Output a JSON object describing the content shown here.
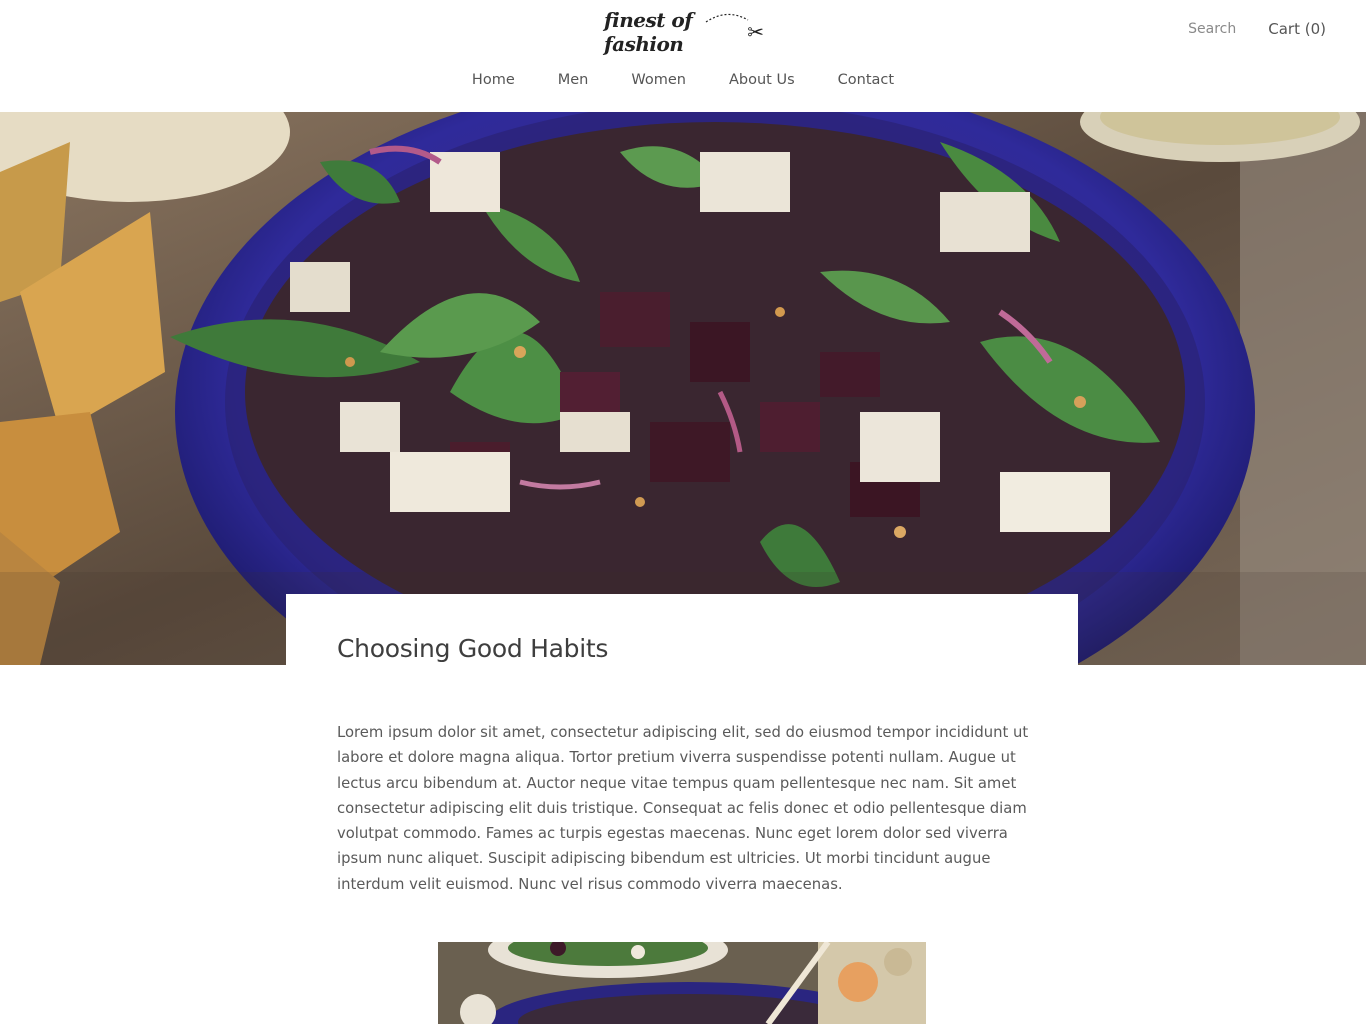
{
  "header": {
    "logo_text": "finest of fashion",
    "search_label": "Search",
    "cart_label": "Cart (0)"
  },
  "nav": {
    "items": [
      "Home",
      "Men",
      "Women",
      "About Us",
      "Contact"
    ]
  },
  "hero": {
    "image_alt": "salad-bowl-photo"
  },
  "article": {
    "title": "Choosing Good Habits",
    "body": "Lorem ipsum dolor sit amet, consectetur adipiscing elit, sed do eiusmod tempor incididunt ut labore et dolore magna aliqua. Tortor pretium viverra suspendisse potenti nullam. Augue ut lectus arcu bibendum at. Auctor neque vitae tempus quam pellentesque nec nam. Sit amet consectetur adipiscing elit duis tristique. Consequat ac felis donec et odio pellentesque diam volutpat commodo. Fames ac turpis egestas maecenas. Nunc eget lorem dolor sed viverra ipsum nunc aliquet. Suscipit adipiscing bibendum est ultricies. Ut morbi tincidunt augue interdum velit euismod. Nunc vel risus commodo viverra maecenas."
  },
  "colors": {
    "accent": "#2b2a8f",
    "text": "#4a4a4a"
  }
}
